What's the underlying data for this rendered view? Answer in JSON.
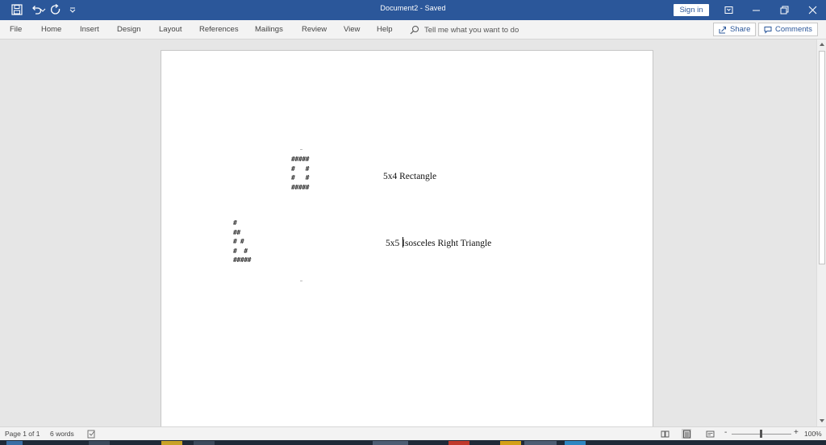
{
  "titlebar": {
    "doc_title": "Document2  -  Saved",
    "sign_in": "Sign in"
  },
  "ribbon": {
    "tabs": [
      "File",
      "Home",
      "Insert",
      "Design",
      "Layout",
      "References",
      "Mailings",
      "Review",
      "View",
      "Help"
    ],
    "tell_me": "Tell me what you want to do",
    "share": "Share",
    "comments": "Comments"
  },
  "document": {
    "rectangle_art": "#####\n#   #\n#   #\n#####",
    "rectangle_label": "5x4 Rectangle",
    "triangle_art": "#\n##\n# #\n#  #\n#####",
    "triangle_label_a": "5x5 ",
    "triangle_label_b": "Isosceles Right Triangle"
  },
  "statusbar": {
    "page": "Page 1 of 1",
    "words": "6 words",
    "zoom": "100%",
    "zoom_minus": "-",
    "zoom_plus": "+"
  },
  "colors": {
    "title_bar": "#2b579a",
    "ribbon_bg": "#f3f3f3",
    "canvas_bg": "#e6e6e6"
  }
}
